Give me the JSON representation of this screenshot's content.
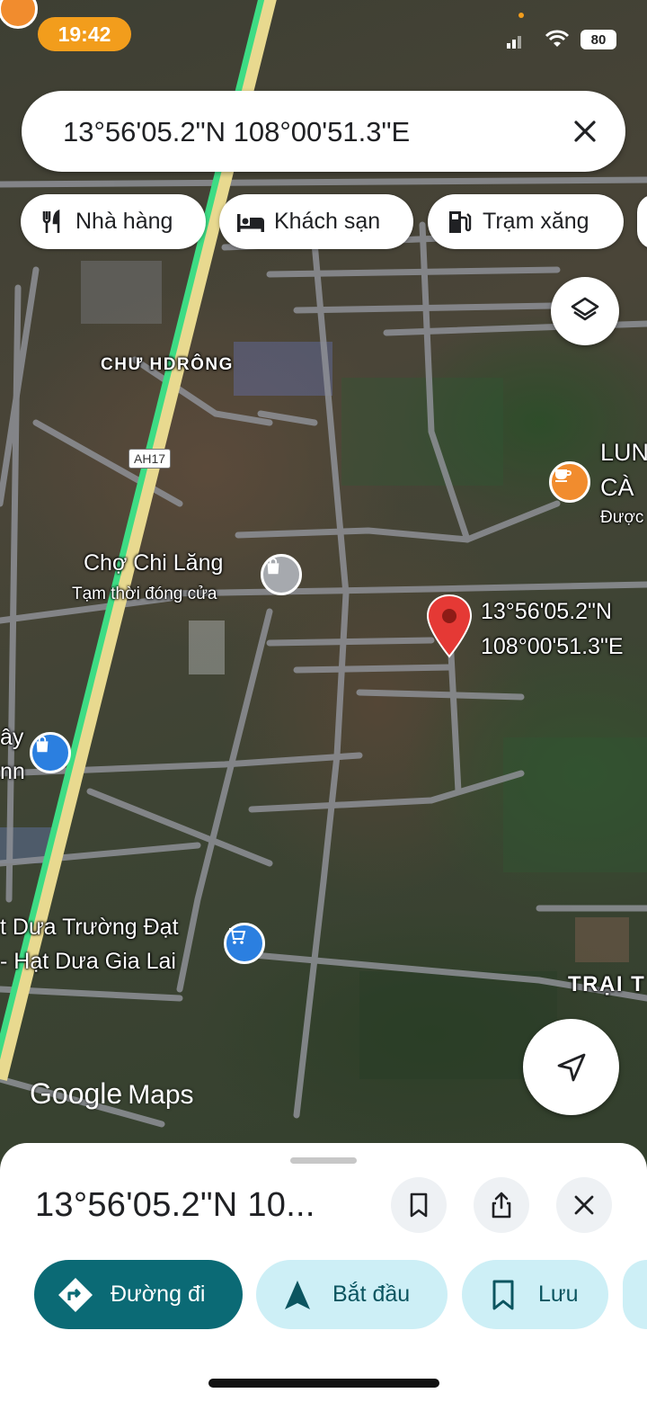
{
  "status_bar": {
    "time": "19:42",
    "battery": "80"
  },
  "search": {
    "query": "13°56'05.2\"N 108°00'51.3\"E"
  },
  "chips": [
    {
      "label": "Nhà hàng",
      "icon": "restaurant-icon"
    },
    {
      "label": "Khách sạn",
      "icon": "hotel-icon"
    },
    {
      "label": "Trạm xăng",
      "icon": "gas-station-icon"
    }
  ],
  "map": {
    "area_labels": {
      "chu_hdrong": "CHƯ HDRÔNG",
      "trai": "TRẠI T",
      "lung": "LUN",
      "ca": "CÀ",
      "duoc": "Được"
    },
    "road_shield": "AH17",
    "pois": {
      "cho_chi_lang": {
        "name": "Chợ Chi Lăng",
        "status": "Tạm thời đóng cửa"
      },
      "hat_dua": {
        "line1": "t Dưa Trường Đạt",
        "line2": "- Hạt Dưa Gia Lai"
      },
      "left_partial": {
        "line1": "ây",
        "line2": "nn"
      }
    },
    "pin_label": {
      "lat": "13°56'05.2\"N",
      "lng": "108°00'51.3\"E"
    },
    "attribution": {
      "google": "Google",
      "maps": "Maps"
    }
  },
  "sheet": {
    "title": "13°56'05.2\"N 10...",
    "actions": [
      {
        "label": "Đường đi",
        "icon": "directions-icon"
      },
      {
        "label": "Bắt đầu",
        "icon": "navigation-arrow-icon"
      },
      {
        "label": "Lưu",
        "icon": "bookmark-icon"
      }
    ]
  },
  "colors": {
    "accent": "#0b6a75",
    "accent_light": "#cdeff6",
    "pin_red": "#e53935",
    "status_orange": "#f29d1c",
    "highway_green": "#3ddc84"
  }
}
